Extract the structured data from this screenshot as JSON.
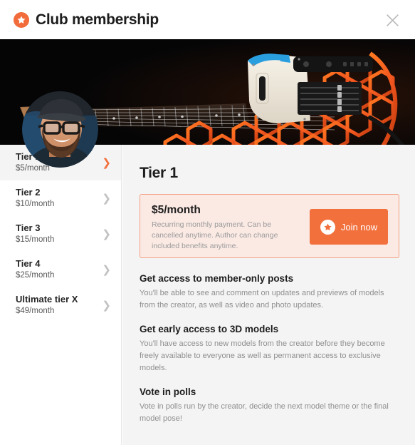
{
  "header": {
    "title": "Club membership",
    "brand_icon": "star-badge-icon",
    "close_icon": "close-icon",
    "accent_color": "#f2703c"
  },
  "banner": {
    "alt": "3D-printed electric guitar with orange honeycomb body on black background",
    "background_color": "#050506",
    "honeycomb_color": "#f2571f",
    "body_color": "#efe8dc",
    "accent_color": "#2a9fe0"
  },
  "avatar": {
    "alt": "Creator portrait: bearded man with glasses and flat cap"
  },
  "sidebar": {
    "tiers": [
      {
        "label": "Tier 1",
        "price": "$5/month",
        "selected": true
      },
      {
        "label": "Tier 2",
        "price": "$10/month",
        "selected": false
      },
      {
        "label": "Tier 3",
        "price": "$15/month",
        "selected": false
      },
      {
        "label": "Tier 4",
        "price": "$25/month",
        "selected": false
      },
      {
        "label": "Ultimate tier X",
        "price": "$49/month",
        "selected": false
      }
    ],
    "chevron_icon": "chevron-right-icon"
  },
  "content": {
    "title": "Tier 1",
    "card": {
      "price": "$5/month",
      "note": "Recurring monthly payment. Can be cancelled anytime. Author can change included benefits anytime.",
      "join_label": "Join now",
      "join_icon": "star-badge-icon",
      "background_color": "#fbeae4",
      "border_color": "#f2a184"
    },
    "benefits": [
      {
        "title": "Get access to member-only posts",
        "description": "You'll be able to see and comment on updates and previews of models from the creator, as well as video and photo updates."
      },
      {
        "title": "Get early access to 3D models",
        "description": "You'll have access to new models from the creator before they become freely available to everyone as well as permanent access to exclusive models."
      },
      {
        "title": "Vote in polls",
        "description": "Vote in polls run by the creator, decide the next model theme or the final model pose!"
      }
    ]
  }
}
